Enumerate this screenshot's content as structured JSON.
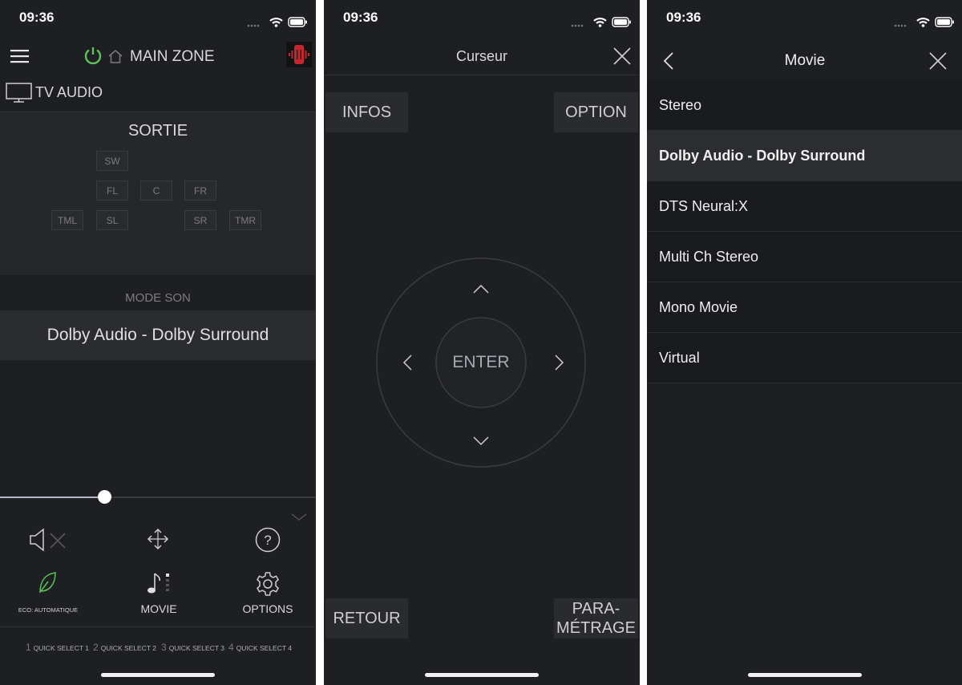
{
  "status": {
    "time": "09:36"
  },
  "screen1": {
    "zone_title": "MAIN ZONE",
    "source_label": "TV AUDIO",
    "output_header": "SORTIE",
    "speakers": [
      "SW",
      "FL",
      "C",
      "FR",
      "TML",
      "SL",
      "SR",
      "TMR"
    ],
    "sound_mode_header": "MODE SON",
    "sound_mode_value": "Dolby Audio - Dolby Surround",
    "volume_level_fraction": 0.33,
    "eco_label": "ECO: AUTOMATIQUE",
    "movie_label": "MOVIE",
    "options_label": "OPTIONS",
    "quick_selects": [
      {
        "num": "1",
        "label": "QUICK SELECT 1"
      },
      {
        "num": "2",
        "label": "QUICK SELECT 2"
      },
      {
        "num": "3",
        "label": "QUICK SELECT 3"
      },
      {
        "num": "4",
        "label": "QUICK SELECT 4"
      }
    ]
  },
  "screen2": {
    "title": "Curseur",
    "infos_label": "INFOS",
    "option_label": "OPTION",
    "enter_label": "ENTER",
    "retour_label": "RETOUR",
    "parametrage_line1": "PARA-",
    "parametrage_line2": "MÉTRAGE"
  },
  "screen3": {
    "title": "Movie",
    "items": [
      "Stereo",
      "Dolby Audio - Dolby Surround",
      "DTS Neural:X",
      "Multi Ch Stereo",
      "Mono Movie",
      "Virtual"
    ],
    "selected_index": 1
  },
  "colors": {
    "power_green": "#5cc35a",
    "background": "#1e1f22"
  }
}
